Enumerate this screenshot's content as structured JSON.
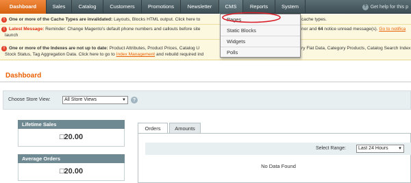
{
  "nav": {
    "items": [
      {
        "label": "Dashboard"
      },
      {
        "label": "Sales"
      },
      {
        "label": "Catalog"
      },
      {
        "label": "Customers"
      },
      {
        "label": "Promotions"
      },
      {
        "label": "Newsletter"
      },
      {
        "label": "CMS"
      },
      {
        "label": "Reports"
      },
      {
        "label": "System"
      }
    ],
    "help_text": "Get help for this p"
  },
  "messages": {
    "cache": {
      "strong": "One or more of the Cache Types are invalidated:",
      "text": "Layouts, Blocks HTML output. Click here to",
      "tail": "cache types."
    },
    "latest": {
      "strong": "Latest Message:",
      "text": "Reminder: Change Magento's default phone numbers and callouts before site",
      "tail_pre": "nor and",
      "tail_count": "64",
      "tail_mid": "notice unread message(s).",
      "tail_link": "Go to notifica",
      "line2": "launch"
    },
    "indexes": {
      "strong": "One or more of the Indexes are not up to date:",
      "text": "Product Attributes, Product Prices, Catalog U",
      "tail": "ry Flat Data, Category Products, Catalog Search Index",
      "line2_pre": "Stock Status, Tag Aggregation Data. Click here to go to",
      "line2_link": "Index Management",
      "line2_post": "and rebuild required ind"
    }
  },
  "page": {
    "title": "Dashboard"
  },
  "store_switcher": {
    "label": "Choose Store View:",
    "selected": "All Store Views",
    "help_glyph": "?"
  },
  "stats": [
    {
      "label": "Lifetime Sales",
      "value": "□20.00"
    },
    {
      "label": "Average Orders",
      "value": "□20.00"
    }
  ],
  "tabs": [
    {
      "label": "Orders"
    },
    {
      "label": "Amounts"
    }
  ],
  "range": {
    "label": "Select Range:",
    "selected": "Last 24 Hours"
  },
  "no_data": "No Data Found",
  "cms_menu": {
    "items": [
      {
        "label": "Pages"
      },
      {
        "label": "Static Blocks"
      },
      {
        "label": "Widgets"
      },
      {
        "label": "Polls"
      }
    ]
  },
  "colors": {
    "accent": "#eb5e00",
    "nav_bg": "#4a5c62",
    "message_bg": "#fcf8e0",
    "highlight": "#d9202a"
  }
}
